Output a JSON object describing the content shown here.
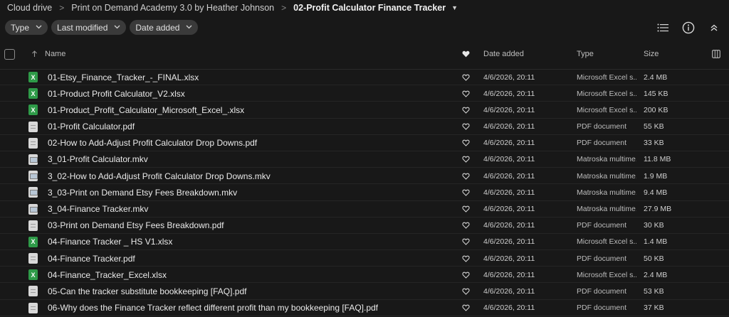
{
  "breadcrumb": {
    "items": [
      "Cloud drive",
      "Print on Demand Academy 3.0 by Heather Johnson",
      "02-Profit Calculator Finance Tracker"
    ],
    "separator": ">"
  },
  "filters": [
    "Type",
    "Last modified",
    "Date added"
  ],
  "columns": {
    "name": "Name",
    "date_added": "Date added",
    "type": "Type",
    "size": "Size"
  },
  "colors": {
    "background": "#181818",
    "chip": "#3a3a3a",
    "excel": "#2e9a48"
  },
  "files": [
    {
      "name": "01-Etsy_Finance_Tracker_-_FINAL.xlsx",
      "icon": "excel-icon",
      "date": "4/6/2026, 20:11",
      "type": "Microsoft Excel s...",
      "size": "2.4 MB"
    },
    {
      "name": "01-Product Profit Calculator_V2.xlsx",
      "icon": "excel-icon",
      "date": "4/6/2026, 20:11",
      "type": "Microsoft Excel s...",
      "size": "145 KB"
    },
    {
      "name": "01-Product_Profit_Calculator_Microsoft_Excel_.xlsx",
      "icon": "excel-icon",
      "date": "4/6/2026, 20:11",
      "type": "Microsoft Excel s...",
      "size": "200 KB"
    },
    {
      "name": "01-Profit Calculator.pdf",
      "icon": "pdf-icon",
      "date": "4/6/2026, 20:11",
      "type": "PDF document",
      "size": "55 KB"
    },
    {
      "name": "02-How to Add-Adjust Profit Calculator Drop Downs.pdf",
      "icon": "pdf-icon",
      "date": "4/6/2026, 20:11",
      "type": "PDF document",
      "size": "33 KB"
    },
    {
      "name": "3_01-Profit Calculator.mkv",
      "icon": "video-icon",
      "date": "4/6/2026, 20:11",
      "type": "Matroska multime...",
      "size": "11.8 MB"
    },
    {
      "name": "3_02-How to Add-Adjust Profit Calculator Drop Downs.mkv",
      "icon": "video-icon",
      "date": "4/6/2026, 20:11",
      "type": "Matroska multime...",
      "size": "1.9 MB"
    },
    {
      "name": "3_03-Print on Demand Etsy Fees Breakdown.mkv",
      "icon": "video-icon",
      "date": "4/6/2026, 20:11",
      "type": "Matroska multime...",
      "size": "9.4 MB"
    },
    {
      "name": "3_04-Finance Tracker.mkv",
      "icon": "video-icon",
      "date": "4/6/2026, 20:11",
      "type": "Matroska multime...",
      "size": "27.9 MB"
    },
    {
      "name": "03-Print on Demand Etsy Fees Breakdown.pdf",
      "icon": "pdf-icon",
      "date": "4/6/2026, 20:11",
      "type": "PDF document",
      "size": "30 KB"
    },
    {
      "name": "04-Finance Tracker _ HS V1.xlsx",
      "icon": "excel-icon",
      "date": "4/6/2026, 20:11",
      "type": "Microsoft Excel s...",
      "size": "1.4 MB"
    },
    {
      "name": "04-Finance Tracker.pdf",
      "icon": "pdf-icon",
      "date": "4/6/2026, 20:11",
      "type": "PDF document",
      "size": "50 KB"
    },
    {
      "name": "04-Finance_Tracker_Excel.xlsx",
      "icon": "excel-icon",
      "date": "4/6/2026, 20:11",
      "type": "Microsoft Excel s...",
      "size": "2.4 MB"
    },
    {
      "name": "05-Can the tracker substitute bookkeeping [FAQ].pdf",
      "icon": "pdf-icon",
      "date": "4/6/2026, 20:11",
      "type": "PDF document",
      "size": "53 KB"
    },
    {
      "name": "06-Why does the Finance Tracker reflect different profit than my bookkeeping [FAQ].pdf",
      "icon": "pdf-icon",
      "date": "4/6/2026, 20:11",
      "type": "PDF document",
      "size": "37 KB"
    }
  ]
}
